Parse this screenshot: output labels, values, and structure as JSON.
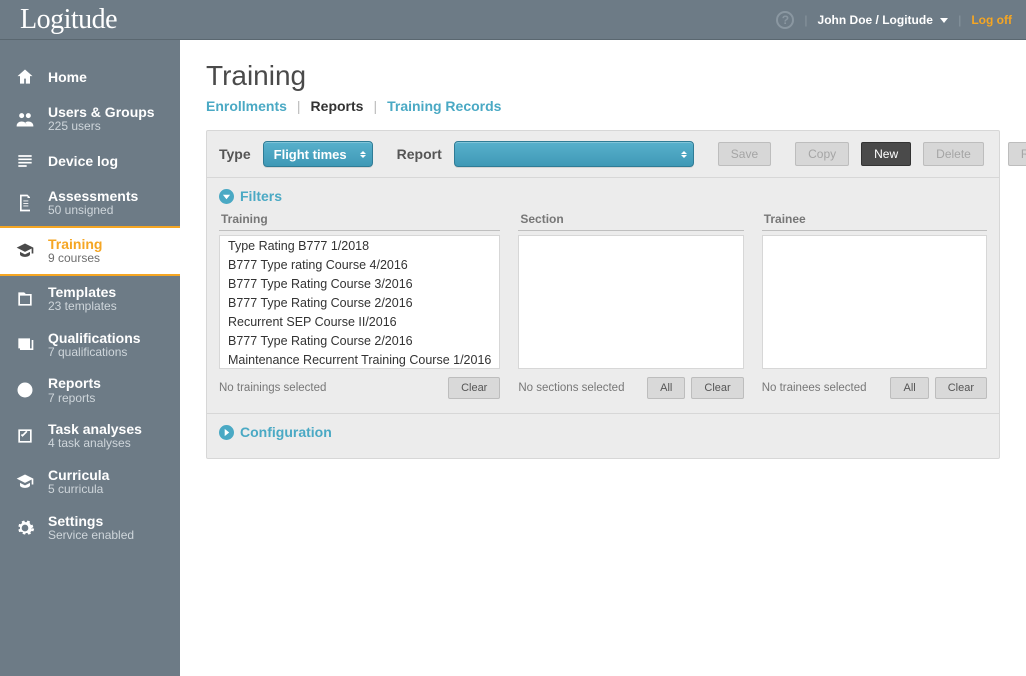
{
  "brand": "Logitude",
  "top": {
    "user_prefix": "John Doe / Logitude",
    "logoff": "Log off"
  },
  "sidebar": [
    {
      "key": "home",
      "title": "Home",
      "sub": ""
    },
    {
      "key": "users",
      "title": "Users & Groups",
      "sub": "225 users"
    },
    {
      "key": "devicelog",
      "title": "Device log",
      "sub": ""
    },
    {
      "key": "assessments",
      "title": "Assessments",
      "sub": "50 unsigned"
    },
    {
      "key": "training",
      "title": "Training",
      "sub": "9 courses",
      "active": true
    },
    {
      "key": "templates",
      "title": "Templates",
      "sub": "23 templates"
    },
    {
      "key": "qualifications",
      "title": "Qualifications",
      "sub": "7 qualifications"
    },
    {
      "key": "reports",
      "title": "Reports",
      "sub": "7 reports"
    },
    {
      "key": "task",
      "title": "Task analyses",
      "sub": "4 task analyses"
    },
    {
      "key": "curricula",
      "title": "Curricula",
      "sub": "5 curricula"
    },
    {
      "key": "settings",
      "title": "Settings",
      "sub": "Service enabled"
    }
  ],
  "page": {
    "title": "Training",
    "tabs": {
      "enrollments": "Enrollments",
      "reports": "Reports",
      "records": "Training Records"
    },
    "active_tab": "reports"
  },
  "toolbar": {
    "type_label": "Type",
    "type_value": "Flight times",
    "report_label": "Report",
    "report_value": "",
    "save": "Save",
    "copy": "Copy",
    "new": "New",
    "delete": "Delete",
    "run": "Run"
  },
  "filters": {
    "heading": "Filters",
    "cols": {
      "training": {
        "title": "Training",
        "items": [
          "Type Rating B777 1/2018",
          "B777 Type rating Course 4/2016",
          "B777 Type Rating Course 3/2016",
          "B777 Type Rating Course 2/2016",
          "Recurrent SEP Course II/2016",
          "B777 Type Rating Course 2/2016",
          "Maintenance Recurrent Training Course 1/2016"
        ],
        "status": "No trainings selected",
        "clear": "Clear"
      },
      "section": {
        "title": "Section",
        "items": [],
        "status": "No sections selected",
        "all": "All",
        "clear": "Clear"
      },
      "trainee": {
        "title": "Trainee",
        "items": [],
        "status": "No trainees selected",
        "all": "All",
        "clear": "Clear"
      }
    }
  },
  "configuration": {
    "heading": "Configuration"
  }
}
